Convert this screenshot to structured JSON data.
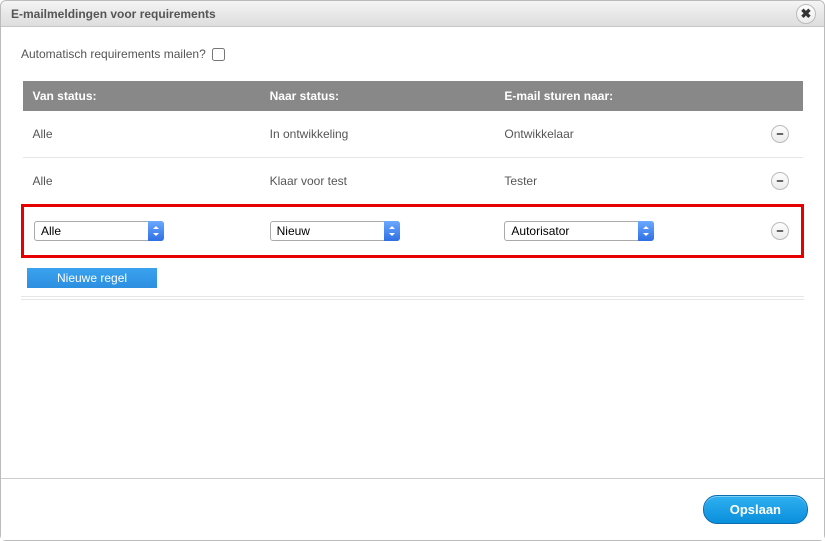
{
  "dialog": {
    "title": "E-mailmeldingen voor requirements",
    "autoMailLabel": "Automatisch requirements mailen?",
    "autoMailChecked": false
  },
  "columns": {
    "fromStatus": "Van status:",
    "toStatus": "Naar status:",
    "sendTo": "E-mail sturen naar:"
  },
  "rows": [
    {
      "from": "Alle",
      "to": "In ontwikkeling",
      "recipient": "Ontwikkelaar"
    },
    {
      "from": "Alle",
      "to": "Klaar voor test",
      "recipient": "Tester"
    }
  ],
  "newRow": {
    "fromSelected": "Alle",
    "toSelected": "Nieuw",
    "recipientSelected": "Autorisator"
  },
  "buttons": {
    "newRule": "Nieuwe regel",
    "save": "Opslaan"
  }
}
